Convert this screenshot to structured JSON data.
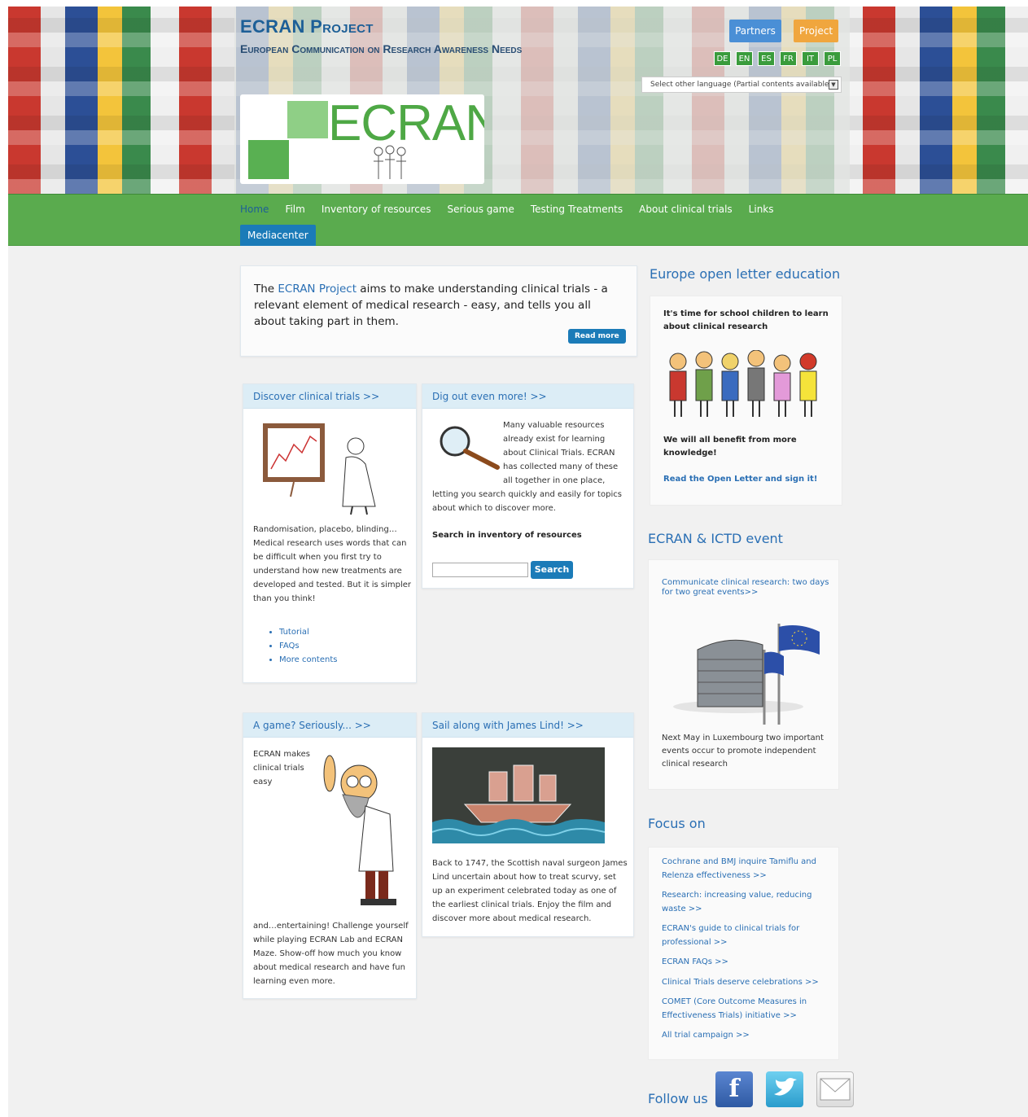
{
  "header": {
    "title": "ECRAN Project",
    "subtitle": "European Communication on Research Awareness Needs",
    "logo_text": "ECRAN",
    "partners_label": "Partners",
    "project_label": "Project",
    "languages": [
      "DE",
      "EN",
      "ES",
      "FR",
      "IT",
      "PL"
    ],
    "language_select": "Select other language (Partial contents available)"
  },
  "nav": {
    "items": [
      "Home",
      "Film",
      "Inventory of resources",
      "Serious game",
      "Testing Treatments",
      "About clinical trials",
      "Links"
    ],
    "mediacenter": "Mediacenter"
  },
  "intro": {
    "prefix": "The ",
    "link": "ECRAN Project",
    "text": " aims to make understanding clinical trials - a relevant element of medical research - easy, and tells you all about taking part in them.",
    "read_more": "Read more"
  },
  "cards": {
    "discover": {
      "title": "Discover clinical trials >>",
      "text": "Randomisation, placebo, blinding… Medical research uses words that can be difficult when you first try to understand how new treatments are developed and tested. But it is simpler than you think!",
      "links": [
        "Tutorial",
        "FAQs",
        "More contents"
      ]
    },
    "dig": {
      "title": "Dig out even more! >>",
      "text_a": "Many valuable resources already exist for learning about Clinical Trials. ECRAN has collected many of these all together in one place,",
      "text_b": "letting you search quickly and easily for topics about which to discover more.",
      "search_label": "Search in inventory of resources",
      "search_button": "Search"
    },
    "game": {
      "title": "A game? Seriously... >>",
      "text_a": "ECRAN makes clinical trials easy",
      "text_b": "and…entertaining! Challenge yourself while playing ECRAN Lab and ECRAN Maze. Show-off how much you know about medical research and have fun learning even more."
    },
    "lind": {
      "title": "Sail along with James Lind! >>",
      "text": "Back to 1747, the Scottish naval surgeon James Lind uncertain about how to treat scurvy, set up an experiment celebrated today as one of the earliest clinical trials. Enjoy the film and discover more about medical research."
    }
  },
  "sidebar": {
    "letter": {
      "title": "Europe open letter education",
      "heading": "It's time for school children to learn about clinical research",
      "text": "We will all benefit from more knowledge!",
      "link": "Read the Open Letter and sign it!"
    },
    "ictd": {
      "title": "ECRAN & ICTD event",
      "link": "Communicate clinical research: two days for two great events>>",
      "text": "Next May in Luxembourg two important events occur to promote independent clinical research"
    },
    "focus": {
      "title": "Focus on",
      "items": [
        "Cochrane and BMJ inquire Tamiflu and Relenza effectiveness >>",
        "Research: increasing value, reducing waste >>",
        "ECRAN's guide to clinical trials for professional >>",
        "ECRAN FAQs >>",
        "Clinical Trials deserve celebrations >>",
        "COMET (Core Outcome Measures in Effectiveness Trials) initiative >>",
        "All trial campaign >>"
      ]
    },
    "follow": "Follow us",
    "social": {
      "facebook": "f"
    }
  },
  "colors": {
    "nav_green": "#5aab4e",
    "link_blue": "#2a6fb4",
    "button_blue": "#1b7bb8",
    "project_orange": "#f0a63e"
  }
}
